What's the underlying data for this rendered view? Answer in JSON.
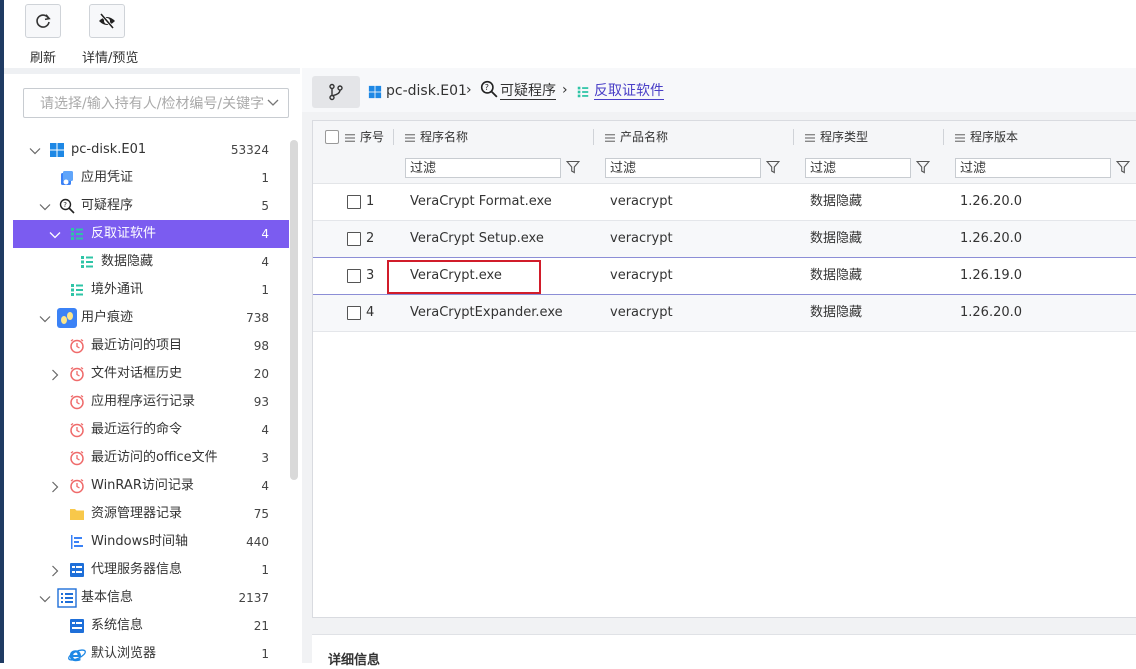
{
  "toolbar": {
    "refresh_label": "刷新",
    "detail_preview_label": "详情/预览"
  },
  "search": {
    "placeholder": "请选择/输入持有人/检材编号/关键字"
  },
  "tree": {
    "items": [
      {
        "label": "pc-disk.E01",
        "count": "53324",
        "icon": "windows-icon"
      },
      {
        "label": "应用凭证",
        "count": "1",
        "icon": "credential-icon"
      },
      {
        "label": "可疑程序",
        "count": "5",
        "icon": "suspicious-search-icon"
      },
      {
        "label": "反取证软件",
        "count": "4",
        "icon": "list-icon"
      },
      {
        "label": "数据隐藏",
        "count": "4",
        "icon": "list-icon"
      },
      {
        "label": "境外通讯",
        "count": "1",
        "icon": "list-icon"
      },
      {
        "label": "用户痕迹",
        "count": "738",
        "icon": "user-trace-icon"
      },
      {
        "label": "最近访问的项目",
        "count": "98",
        "icon": "clock-icon"
      },
      {
        "label": "文件对话框历史",
        "count": "20",
        "icon": "clock-icon"
      },
      {
        "label": "应用程序运行记录",
        "count": "93",
        "icon": "clock-icon"
      },
      {
        "label": "最近运行的命令",
        "count": "4",
        "icon": "clock-icon"
      },
      {
        "label": "最近访问的office文件",
        "count": "3",
        "icon": "clock-icon"
      },
      {
        "label": "WinRAR访问记录",
        "count": "4",
        "icon": "clock-icon"
      },
      {
        "label": "资源管理器记录",
        "count": "75",
        "icon": "folder-icon"
      },
      {
        "label": "Windows时间轴",
        "count": "440",
        "icon": "timeline-icon"
      },
      {
        "label": "代理服务器信息",
        "count": "1",
        "icon": "proxy-icon"
      },
      {
        "label": "基本信息",
        "count": "2137",
        "icon": "basic-info-icon"
      },
      {
        "label": "系统信息",
        "count": "21",
        "icon": "system-info-icon"
      },
      {
        "label": "默认浏览器",
        "count": "1",
        "icon": "ie-icon"
      }
    ]
  },
  "breadcrumb": {
    "root": "pc-disk.E01",
    "level1": "可疑程序",
    "level2": "反取证软件"
  },
  "table": {
    "headers": [
      "序号",
      "程序名称",
      "产品名称",
      "程序类型",
      "程序版本"
    ],
    "filter_placeholder": "过滤",
    "rows": [
      {
        "no": "1",
        "name": "VeraCrypt Format.exe",
        "product": "veracrypt",
        "type": "数据隐藏",
        "version": "1.26.20.0"
      },
      {
        "no": "2",
        "name": "VeraCrypt Setup.exe",
        "product": "veracrypt",
        "type": "数据隐藏",
        "version": "1.26.20.0"
      },
      {
        "no": "3",
        "name": "VeraCrypt.exe",
        "product": "veracrypt",
        "type": "数据隐藏",
        "version": "1.26.19.0"
      },
      {
        "no": "4",
        "name": "VeraCryptExpander.exe",
        "product": "veracrypt",
        "type": "数据隐藏",
        "version": "1.26.20.0"
      }
    ]
  },
  "detail": {
    "title": "详细信息"
  },
  "colors": {
    "selected": "#7b5cf0",
    "highlight_box": "#d11c2a",
    "accent_link": "#4a3fc7"
  }
}
